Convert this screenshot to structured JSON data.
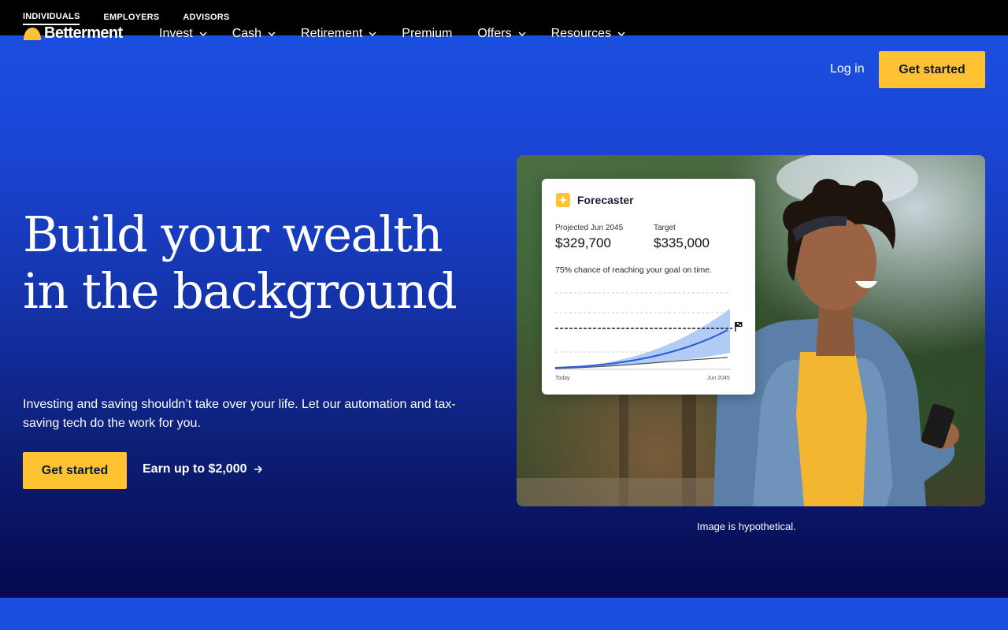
{
  "audience_tabs": [
    {
      "label": "INDIVIDUALS",
      "active": true
    },
    {
      "label": "EMPLOYERS",
      "active": false
    },
    {
      "label": "ADVISORS",
      "active": false
    }
  ],
  "brand": {
    "name": "Betterment",
    "accent_yellow": "#ffc233",
    "brand_blue": "#1b4fe0"
  },
  "nav": {
    "items": [
      {
        "label": "Invest",
        "dropdown": true
      },
      {
        "label": "Cash",
        "dropdown": true
      },
      {
        "label": "Retirement",
        "dropdown": true
      },
      {
        "label": "Premium",
        "dropdown": false
      },
      {
        "label": "Offers",
        "dropdown": true
      },
      {
        "label": "Resources",
        "dropdown": true
      }
    ],
    "login_label": "Log in",
    "cta_label": "Get started"
  },
  "hero": {
    "title": "Build your wealth in the background",
    "subtitle": "Investing and saving shouldn’t take over your life. Let our automation and tax-saving tech do the work for you.",
    "cta_label": "Get started",
    "secondary_link": "Earn up to $2,000",
    "image_caption": "Image is hypothetical."
  },
  "forecaster": {
    "title": "Forecaster",
    "projected_label": "Projected Jun 2045",
    "projected_value": "$329,700",
    "target_label": "Target",
    "target_value": "$335,000",
    "chance_text": "75% chance of reaching your goal on time.",
    "x_start_label": "Today",
    "x_end_label": "Jun 2045"
  }
}
